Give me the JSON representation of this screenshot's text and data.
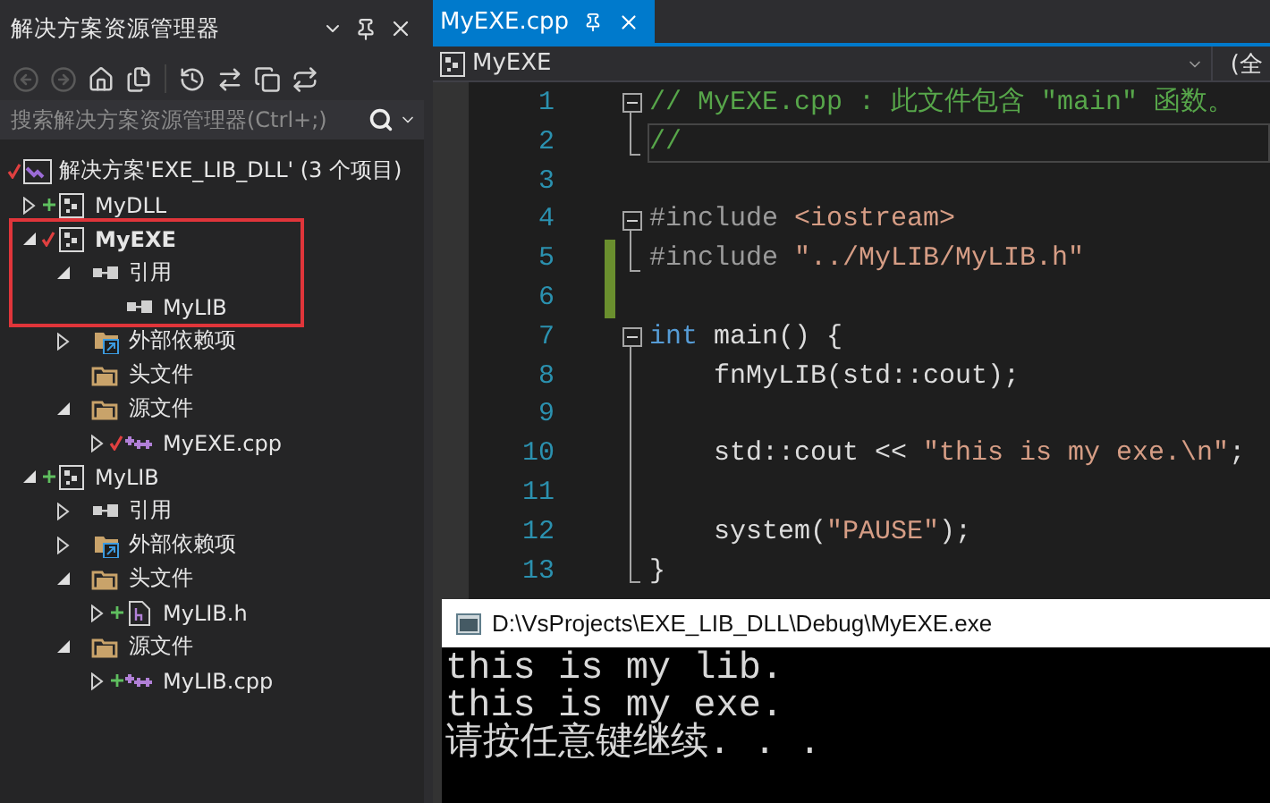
{
  "solution_explorer": {
    "title": "解决方案资源管理器",
    "toolbar": [
      {
        "kind": "back",
        "disabled": true
      },
      {
        "kind": "forward",
        "disabled": true
      },
      {
        "kind": "home",
        "disabled": false
      },
      {
        "kind": "switch_views",
        "disabled": false
      },
      {
        "kind": "pending_changes",
        "disabled": false
      },
      {
        "kind": "sync",
        "disabled": false
      },
      {
        "kind": "collapse_all",
        "disabled": false
      },
      {
        "kind": "show_all_files",
        "disabled": false
      }
    ],
    "search": {
      "placeholder": "搜索解决方案资源管理器(Ctrl+;)"
    },
    "solution": {
      "label": "解决方案'EXE_LIB_DLL' (3 个项目)",
      "checked_in": true
    },
    "tree": [
      {
        "label": "MyDLL",
        "kind": "project",
        "added": true,
        "checked_in": false,
        "expanded": false,
        "startup": false,
        "outlined": false
      },
      {
        "label": "MyEXE",
        "kind": "project",
        "added": false,
        "checked_in": true,
        "expanded": true,
        "startup": true,
        "outlined": true,
        "children": [
          {
            "label": "引用",
            "kind": "references",
            "added": false,
            "checked_in": false,
            "expanded": true,
            "outlined": true,
            "children": [
              {
                "label": "MyLIB",
                "kind": "reference",
                "added": false,
                "checked_in": false,
                "outlined": true
              }
            ]
          },
          {
            "label": "外部依赖项",
            "kind": "external_deps",
            "added": false,
            "checked_in": false,
            "expanded": false,
            "outlined": false
          },
          {
            "label": "头文件",
            "kind": "filter",
            "added": false,
            "checked_in": false,
            "outlined": false
          },
          {
            "label": "源文件",
            "kind": "filter",
            "added": false,
            "checked_in": false,
            "expanded": true,
            "outlined": false,
            "children": [
              {
                "label": "MyEXE.cpp",
                "kind": "cpp",
                "added": false,
                "checked_in": true,
                "expanded": false,
                "outlined": false
              }
            ]
          }
        ]
      },
      {
        "label": "MyLIB",
        "kind": "project",
        "added": true,
        "checked_in": false,
        "expanded": true,
        "startup": false,
        "outlined": false,
        "children": [
          {
            "label": "引用",
            "kind": "references",
            "added": false,
            "checked_in": false,
            "expanded": false,
            "outlined": false
          },
          {
            "label": "外部依赖项",
            "kind": "external_deps",
            "added": false,
            "checked_in": false,
            "expanded": false,
            "outlined": false
          },
          {
            "label": "头文件",
            "kind": "filter",
            "added": false,
            "checked_in": false,
            "expanded": true,
            "outlined": false,
            "children": [
              {
                "label": "MyLIB.h",
                "kind": "header",
                "added": true,
                "checked_in": false,
                "expanded": false,
                "outlined": false
              }
            ]
          },
          {
            "label": "源文件",
            "kind": "filter",
            "added": false,
            "checked_in": false,
            "expanded": true,
            "outlined": false,
            "children": [
              {
                "label": "MyLIB.cpp",
                "kind": "cpp",
                "added": true,
                "checked_in": false,
                "expanded": false,
                "outlined": false
              }
            ]
          }
        ]
      }
    ]
  },
  "editor": {
    "tabs": [
      {
        "label": "MyEXE.cpp",
        "selected": true
      }
    ],
    "nav": {
      "project": "MyEXE",
      "scope": "(全"
    },
    "lines": [
      {
        "number": "1",
        "fold": true,
        "fold_end": false,
        "current": false,
        "changed": false,
        "tokens": [
          {
            "kind": "comment",
            "text": "// MyEXE.cpp : 此文件包含 \"main\" 函数。"
          }
        ]
      },
      {
        "number": "2",
        "fold": false,
        "fold_end": true,
        "current": true,
        "changed": false,
        "tokens": [
          {
            "kind": "comment",
            "text": "//"
          }
        ]
      },
      {
        "number": "3",
        "fold": false,
        "fold_end": false,
        "current": false,
        "changed": false
      },
      {
        "number": "4",
        "fold": true,
        "fold_end": false,
        "current": false,
        "changed": false,
        "tokens": [
          {
            "kind": "preprocessor",
            "text": "#include "
          },
          {
            "kind": "string",
            "text": "<iostream>"
          }
        ]
      },
      {
        "number": "5",
        "fold": false,
        "fold_end": true,
        "current": false,
        "changed": true,
        "tokens": [
          {
            "kind": "preprocessor",
            "text": "#include "
          },
          {
            "kind": "string",
            "text": "\"../MyLIB/MyLIB.h\""
          }
        ]
      },
      {
        "number": "6",
        "fold": false,
        "fold_end": false,
        "current": false,
        "changed": true
      },
      {
        "number": "7",
        "fold": true,
        "fold_end": false,
        "current": false,
        "changed": false,
        "tokens": [
          {
            "kind": "keyword",
            "text": "int"
          },
          {
            "kind": "plain",
            "text": " main() {"
          }
        ]
      },
      {
        "number": "8",
        "fold": false,
        "fold_end": false,
        "current": false,
        "changed": false,
        "tokens": [
          {
            "kind": "plain",
            "text": "    fnMyLIB(std::cout);"
          }
        ]
      },
      {
        "number": "9",
        "fold": false,
        "fold_end": false,
        "current": false,
        "changed": false
      },
      {
        "number": "10",
        "fold": false,
        "fold_end": false,
        "current": false,
        "changed": false,
        "tokens": [
          {
            "kind": "plain",
            "text": "    std::cout << "
          },
          {
            "kind": "string",
            "text": "\"this is my exe.\\n\""
          },
          {
            "kind": "plain",
            "text": ";"
          }
        ]
      },
      {
        "number": "11",
        "fold": false,
        "fold_end": false,
        "current": false,
        "changed": false
      },
      {
        "number": "12",
        "fold": false,
        "fold_end": false,
        "current": false,
        "changed": false,
        "tokens": [
          {
            "kind": "plain",
            "text": "    system("
          },
          {
            "kind": "string",
            "text": "\"PAUSE\""
          },
          {
            "kind": "plain",
            "text": ");"
          }
        ]
      },
      {
        "number": "13",
        "fold": false,
        "fold_end": true,
        "current": false,
        "changed": false,
        "tokens": [
          {
            "kind": "plain",
            "text": "}"
          }
        ]
      }
    ]
  },
  "console": {
    "title": "D:\\VsProjects\\EXE_LIB_DLL\\Debug\\MyEXE.exe",
    "lines": [
      "this is my lib.",
      "this is my exe.",
      "请按任意键继续. . ."
    ]
  }
}
